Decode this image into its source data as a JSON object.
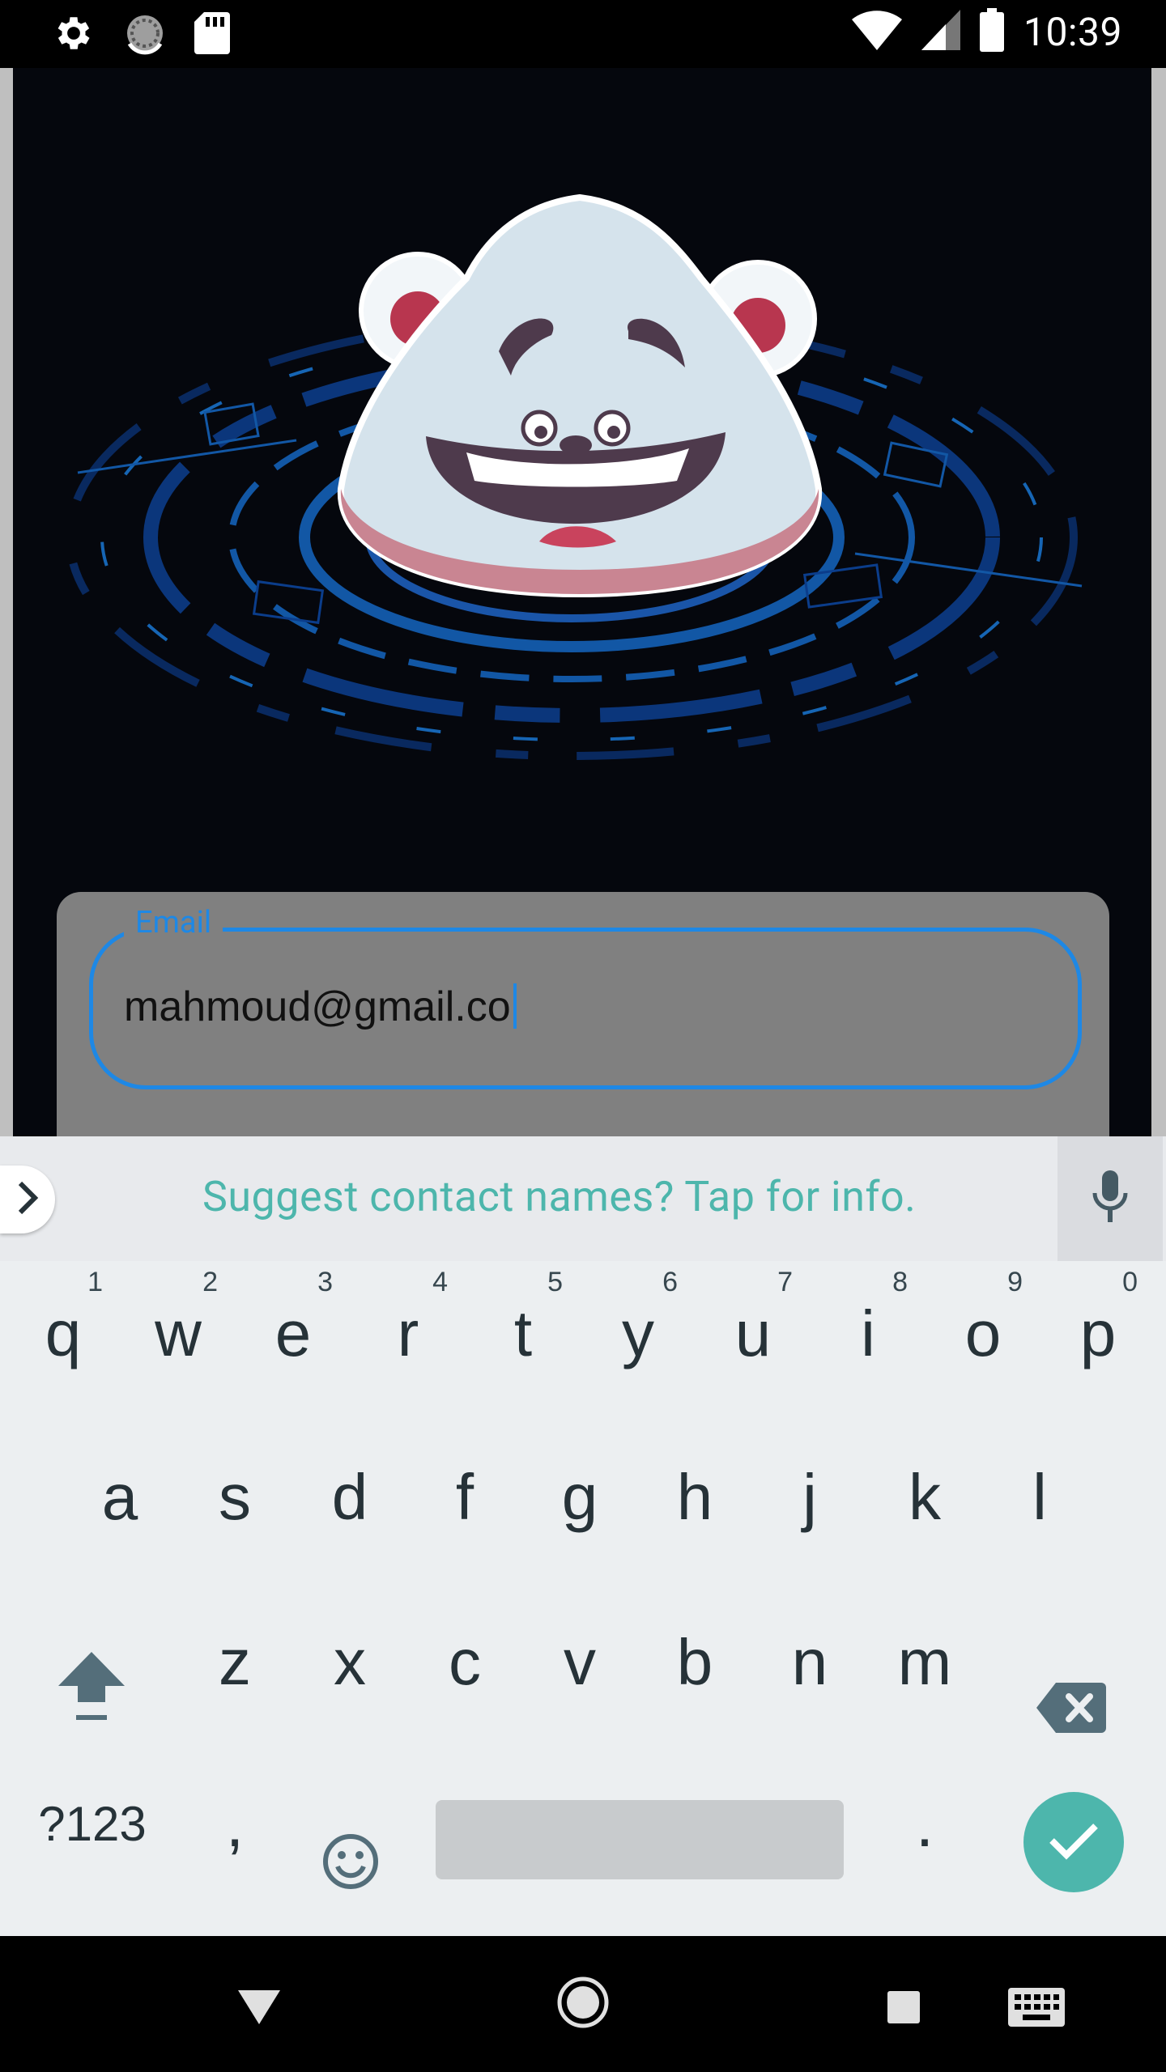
{
  "status_bar": {
    "time": "10:39",
    "left_icons": [
      "settings-icon",
      "sync-icon",
      "sd-card-icon"
    ],
    "right_icons": [
      "wifi-icon",
      "cell-signal-icon",
      "battery-icon"
    ]
  },
  "login_form": {
    "email_label": "Email",
    "email_value": "mahmoud@gmail.co"
  },
  "keyboard": {
    "suggestion": "Suggest contact names? Tap for info.",
    "row1": [
      {
        "key": "q",
        "hint": "1"
      },
      {
        "key": "w",
        "hint": "2"
      },
      {
        "key": "e",
        "hint": "3"
      },
      {
        "key": "r",
        "hint": "4"
      },
      {
        "key": "t",
        "hint": "5"
      },
      {
        "key": "y",
        "hint": "6"
      },
      {
        "key": "u",
        "hint": "7"
      },
      {
        "key": "i",
        "hint": "8"
      },
      {
        "key": "o",
        "hint": "9"
      },
      {
        "key": "p",
        "hint": "0"
      }
    ],
    "row2": [
      "a",
      "s",
      "d",
      "f",
      "g",
      "h",
      "j",
      "k",
      "l"
    ],
    "row3": [
      "z",
      "x",
      "c",
      "v",
      "b",
      "n",
      "m"
    ],
    "symbols_label": "?123",
    "comma": ",",
    "period": ".",
    "accent_color": "#4db6ac"
  },
  "nav_bar": {
    "buttons": [
      "back-icon",
      "home-icon",
      "recents-icon",
      "keyboard-switch-icon"
    ]
  },
  "colors": {
    "focus_blue": "#1e88e5",
    "panel_gray": "#808080",
    "app_background": "#05070d"
  }
}
